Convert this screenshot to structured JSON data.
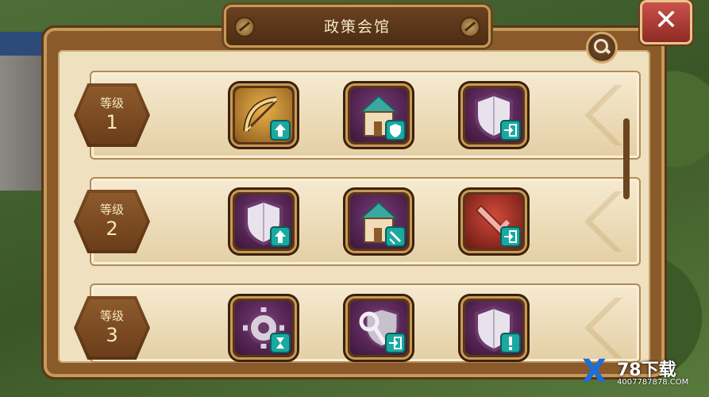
{
  "window": {
    "title": "政策会馆",
    "close_label": "✕"
  },
  "levels": [
    {
      "label": "等级",
      "number": "1",
      "items": [
        {
          "icon": "bow-upgrade-icon",
          "frame": "gold",
          "badge": "arrow-up"
        },
        {
          "icon": "house-shield-icon",
          "frame": "purple",
          "badge": "shield"
        },
        {
          "icon": "shield-enter-icon",
          "frame": "purple",
          "badge": "enter"
        }
      ]
    },
    {
      "label": "等级",
      "number": "2",
      "items": [
        {
          "icon": "shield-upgrade-icon",
          "frame": "purple",
          "badge": "arrow-up"
        },
        {
          "icon": "house-sword-icon",
          "frame": "purple",
          "badge": "sword"
        },
        {
          "icon": "sword-enter-icon",
          "frame": "red",
          "badge": "enter"
        }
      ]
    },
    {
      "label": "等级",
      "number": "3",
      "items": [
        {
          "icon": "gear-hourglass-icon",
          "frame": "purple",
          "badge": "hourglass"
        },
        {
          "icon": "key-shield-enter-icon",
          "frame": "purple",
          "badge": "enter"
        },
        {
          "icon": "shield-alert-icon",
          "frame": "purple",
          "badge": "exclamation"
        }
      ]
    }
  ],
  "watermark": {
    "logo": "X",
    "title": "78下载",
    "sub": "4007787878.COM"
  },
  "colors": {
    "frame_wood": "#8a5a2a",
    "parchment": "#efe0bf",
    "badge_teal": "#1aa9a0",
    "close_red": "#c9524a"
  }
}
